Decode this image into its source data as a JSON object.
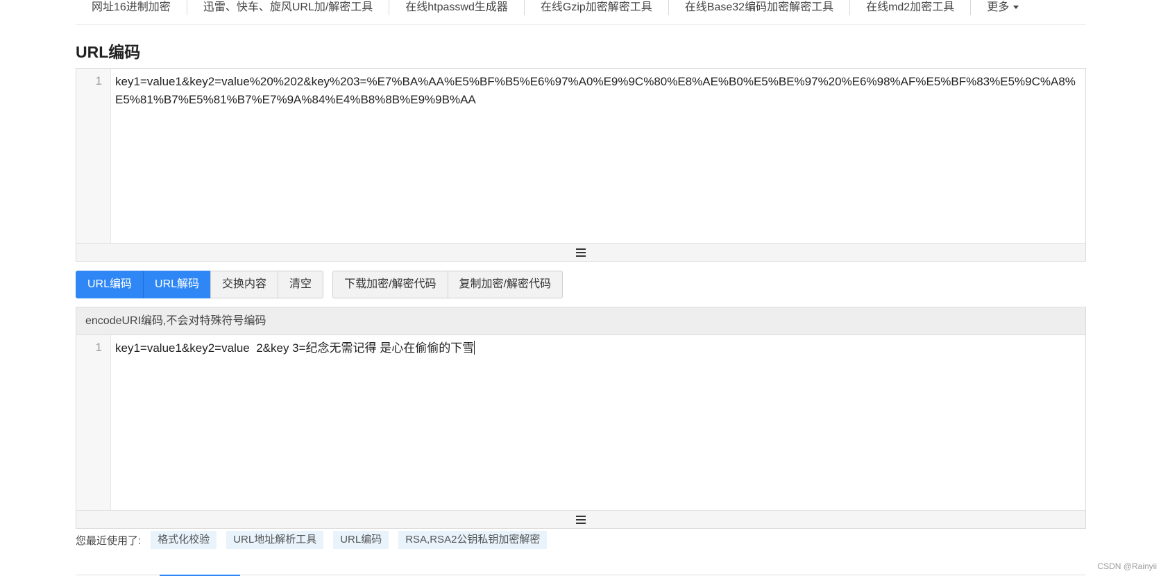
{
  "nav": {
    "items": [
      "网址16进制加密",
      "迅雷、快车、旋风URL加/解密工具",
      "在线htpasswd生成器",
      "在线Gzip加密解密工具",
      "在线Base32编码加密解密工具",
      "在线md2加密工具"
    ],
    "more": "更多"
  },
  "page_title": "URL编码",
  "input_editor": {
    "line_number": "1",
    "content": "key1=value1&key2=value%20%202&key%203=%E7%BA%AA%E5%BF%B5%E6%97%A0%E9%9C%80%E8%AE%B0%E5%BE%97%20%E6%98%AF%E5%BF%83%E5%9C%A8%E5%81%B7%E5%81%B7%E7%9A%84%E4%B8%8B%E9%9B%AA"
  },
  "buttons": {
    "encode": "URL编码",
    "decode": "URL解码",
    "swap": "交换内容",
    "clear": "清空",
    "download_code": "下载加密/解密代码",
    "copy_code": "复制加密/解密代码"
  },
  "output_editor": {
    "header": "encodeURI编码,不会对特殊符号编码",
    "line_number": "1",
    "content": "key1=value1&key2=value  2&key 3=纪念无需记得 是心在偷偷的下雪"
  },
  "recent": {
    "label": "您最近使用了:",
    "items": [
      "格式化校验",
      "URL地址解析工具",
      "URL编码",
      "RSA,RSA2公钥私钥加密解密"
    ]
  },
  "watermark": "CSDN @Rainyii",
  "colors": {
    "primary": "#2f87f5",
    "tag_bg": "#e8f3fb"
  }
}
